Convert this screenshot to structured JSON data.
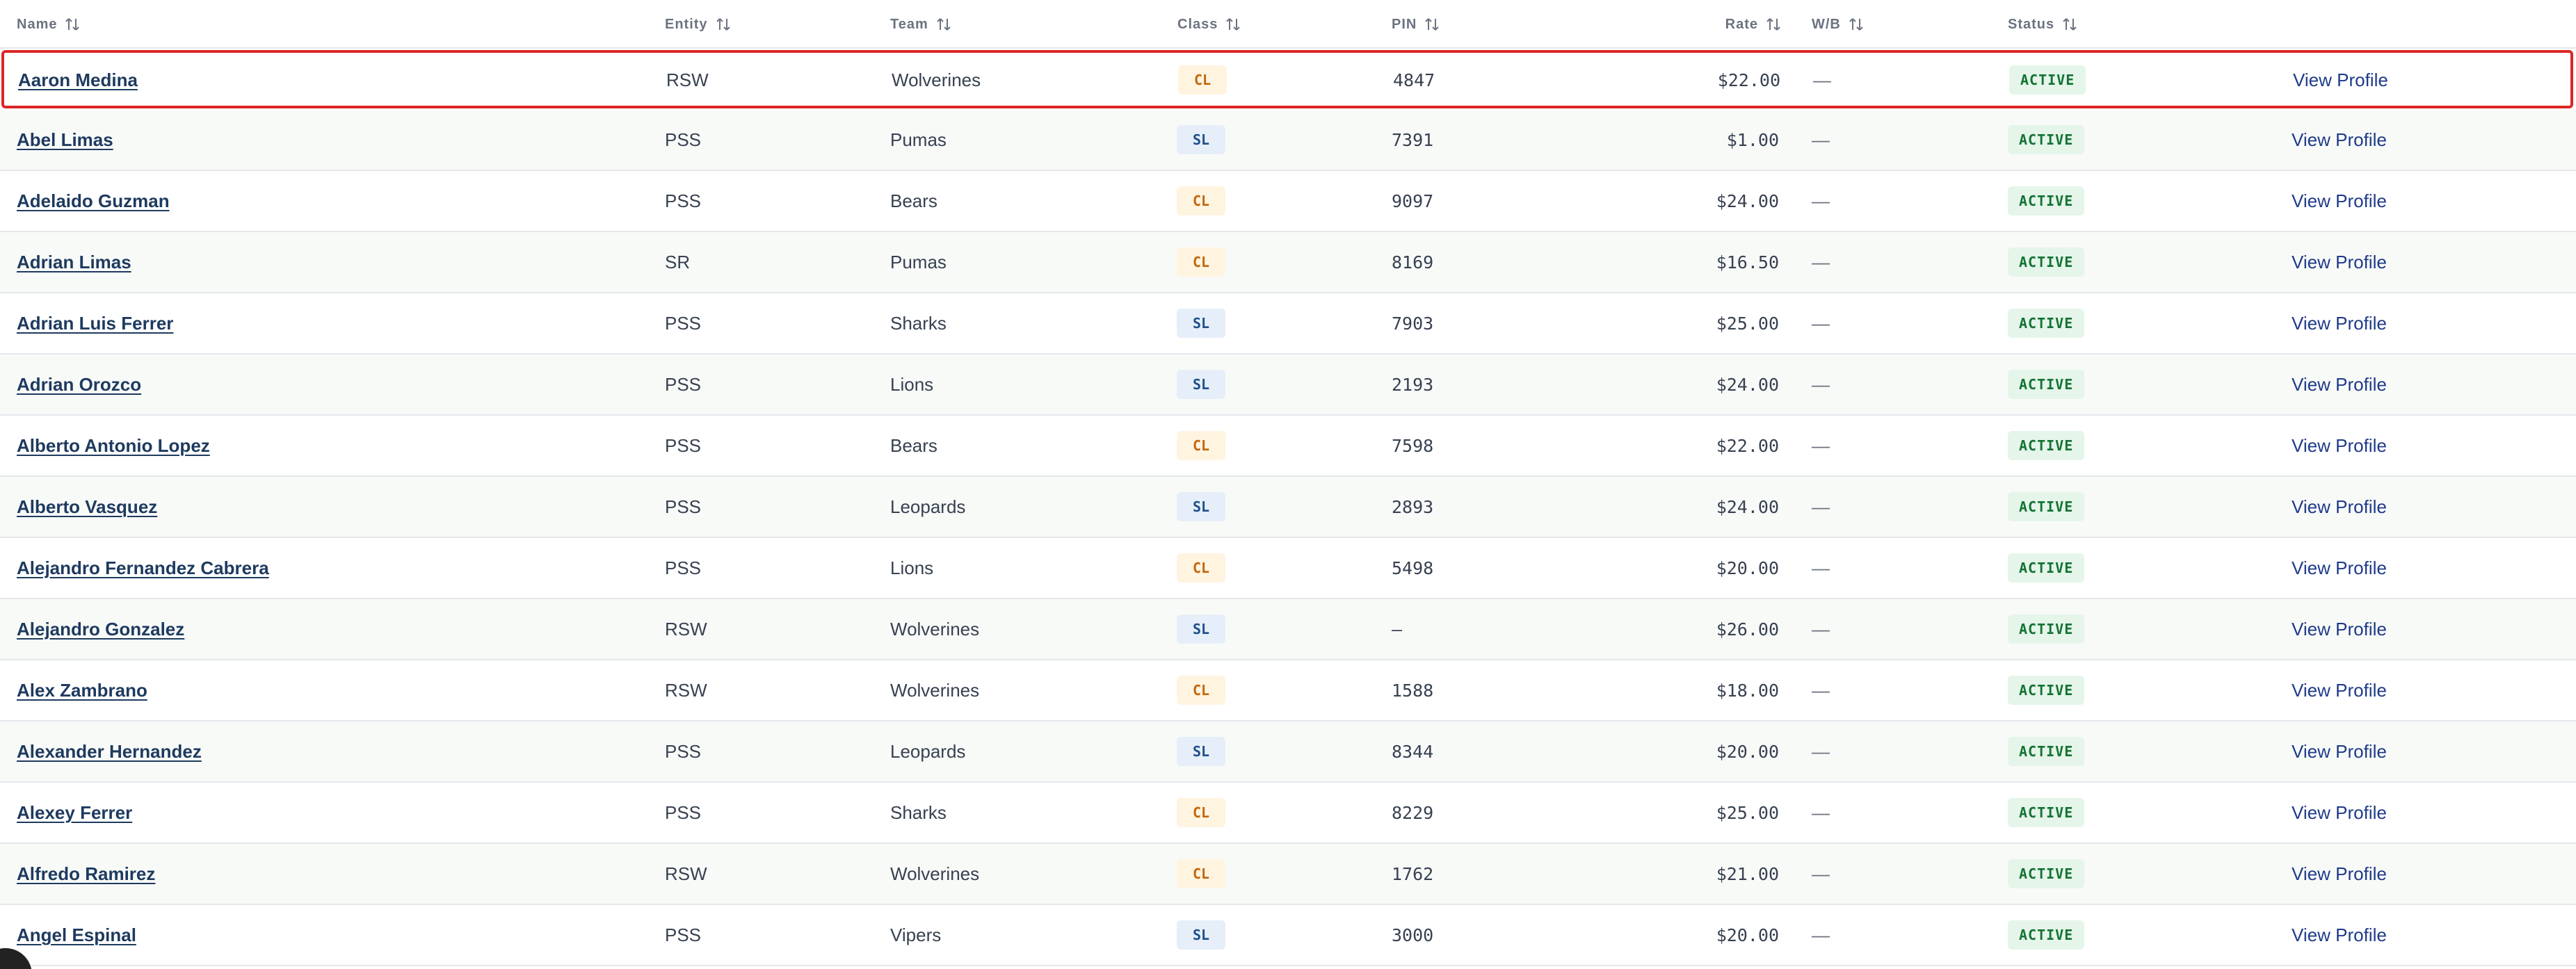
{
  "columns": {
    "name": "Name",
    "entity": "Entity",
    "team": "Team",
    "class": "Class",
    "pin": "PIN",
    "rate": "Rate",
    "wb": "W/B",
    "status": "Status"
  },
  "action_label": "View Profile",
  "colors": {
    "highlight_border": "#dc2626",
    "class_cl_text": "#c2660a",
    "class_sl_text": "#1e4f8c",
    "status_text": "#137333"
  },
  "rows": [
    {
      "name": "Aaron Medina",
      "entity": "RSW",
      "team": "Wolverines",
      "class": "CL",
      "pin": "4847",
      "rate": "$22.00",
      "wb": "—",
      "status": "ACTIVE",
      "selected": true
    },
    {
      "name": "Abel Limas",
      "entity": "PSS",
      "team": "Pumas",
      "class": "SL",
      "pin": "7391",
      "rate": "$1.00",
      "wb": "—",
      "status": "ACTIVE"
    },
    {
      "name": "Adelaido Guzman",
      "entity": "PSS",
      "team": "Bears",
      "class": "CL",
      "pin": "9097",
      "rate": "$24.00",
      "wb": "—",
      "status": "ACTIVE"
    },
    {
      "name": "Adrian Limas",
      "entity": "SR",
      "team": "Pumas",
      "class": "CL",
      "pin": "8169",
      "rate": "$16.50",
      "wb": "—",
      "status": "ACTIVE"
    },
    {
      "name": "Adrian Luis Ferrer",
      "entity": "PSS",
      "team": "Sharks",
      "class": "SL",
      "pin": "7903",
      "rate": "$25.00",
      "wb": "—",
      "status": "ACTIVE"
    },
    {
      "name": "Adrian Orozco",
      "entity": "PSS",
      "team": "Lions",
      "class": "SL",
      "pin": "2193",
      "rate": "$24.00",
      "wb": "—",
      "status": "ACTIVE"
    },
    {
      "name": "Alberto Antonio Lopez",
      "entity": "PSS",
      "team": "Bears",
      "class": "CL",
      "pin": "7598",
      "rate": "$22.00",
      "wb": "—",
      "status": "ACTIVE"
    },
    {
      "name": "Alberto Vasquez",
      "entity": "PSS",
      "team": "Leopards",
      "class": "SL",
      "pin": "2893",
      "rate": "$24.00",
      "wb": "—",
      "status": "ACTIVE"
    },
    {
      "name": "Alejandro Fernandez Cabrera",
      "entity": "PSS",
      "team": "Lions",
      "class": "CL",
      "pin": "5498",
      "rate": "$20.00",
      "wb": "—",
      "status": "ACTIVE"
    },
    {
      "name": "Alejandro Gonzalez",
      "entity": "RSW",
      "team": "Wolverines",
      "class": "SL",
      "pin": "—",
      "rate": "$26.00",
      "wb": "—",
      "status": "ACTIVE"
    },
    {
      "name": "Alex Zambrano",
      "entity": "RSW",
      "team": "Wolverines",
      "class": "CL",
      "pin": "1588",
      "rate": "$18.00",
      "wb": "—",
      "status": "ACTIVE"
    },
    {
      "name": "Alexander Hernandez",
      "entity": "PSS",
      "team": "Leopards",
      "class": "SL",
      "pin": "8344",
      "rate": "$20.00",
      "wb": "—",
      "status": "ACTIVE"
    },
    {
      "name": "Alexey Ferrer",
      "entity": "PSS",
      "team": "Sharks",
      "class": "CL",
      "pin": "8229",
      "rate": "$25.00",
      "wb": "—",
      "status": "ACTIVE"
    },
    {
      "name": "Alfredo Ramirez",
      "entity": "RSW",
      "team": "Wolverines",
      "class": "CL",
      "pin": "1762",
      "rate": "$21.00",
      "wb": "—",
      "status": "ACTIVE"
    },
    {
      "name": "Angel Espinal",
      "entity": "PSS",
      "team": "Vipers",
      "class": "SL",
      "pin": "3000",
      "rate": "$20.00",
      "wb": "—",
      "status": "ACTIVE"
    }
  ]
}
